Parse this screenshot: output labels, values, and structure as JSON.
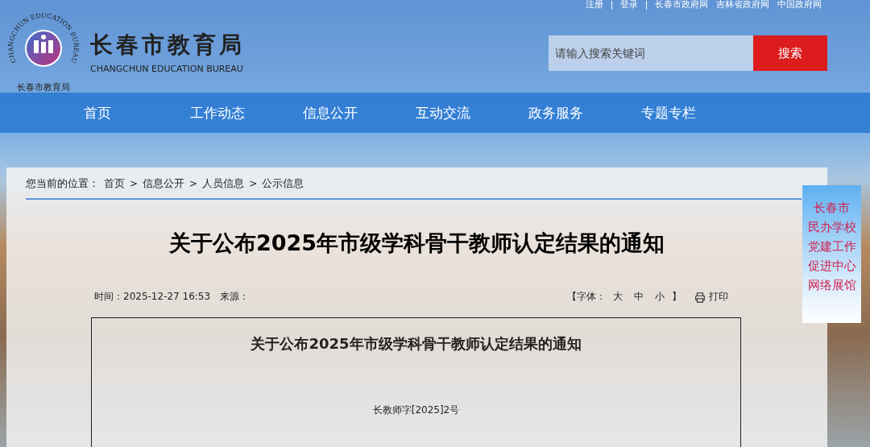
{
  "top_links": [
    {
      "label": "注册",
      "divider_after": true
    },
    {
      "label": "登录",
      "divider_after": true
    },
    {
      "label": "长春市政府网",
      "divider_after": false
    },
    {
      "label": "吉林省政府网",
      "divider_after": false
    },
    {
      "label": "中国政府网",
      "divider_after": false
    }
  ],
  "logo": {
    "ring_text": "CHANGCHUN EDUCATION BUREAU",
    "bottom_text": "长春市教育局",
    "title": "长春市教育局",
    "subtitle": "CHANGCHUN EDUCATION BUREAU"
  },
  "search": {
    "placeholder": "请输入搜索关键词",
    "button": "搜索"
  },
  "nav": [
    {
      "label": "首页"
    },
    {
      "label": "工作动态"
    },
    {
      "label": "信息公开"
    },
    {
      "label": "互动交流"
    },
    {
      "label": "政务服务"
    },
    {
      "label": "专题专栏"
    }
  ],
  "breadcrumb": {
    "prefix": "您当前的位置：",
    "items": [
      "首页",
      "信息公开",
      "人员信息",
      "公示信息"
    ],
    "separator": ">"
  },
  "article": {
    "title": "关于公布2025年市级学科骨干教师认定结果的通知",
    "time": "时间：2025-12-27 16:53",
    "source": "来源：",
    "font_label": "【字体：",
    "font_sizes": [
      "大",
      "中",
      "小"
    ],
    "font_close": "】",
    "print": "打印"
  },
  "document": {
    "title": "关于公布2025年市级学科骨干教师认定结果的通知",
    "number": "长教师字[2025]2号"
  },
  "side_banner": {
    "lines": [
      "长春市",
      "民办学校",
      "党建工作",
      "促进中心",
      "网络展馆"
    ]
  }
}
